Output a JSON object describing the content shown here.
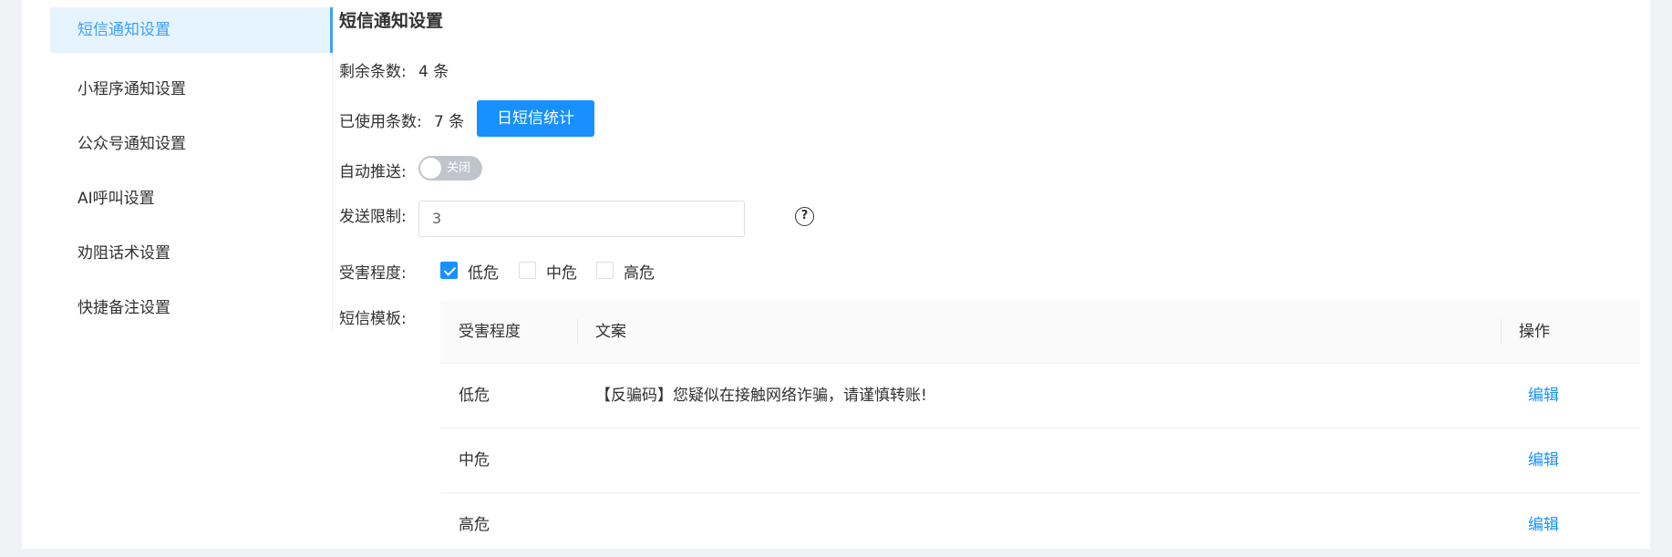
{
  "sidebar": {
    "items": [
      {
        "label": "短信通知设置",
        "active": true
      },
      {
        "label": "小程序通知设置"
      },
      {
        "label": "公众号通知设置"
      },
      {
        "label": "AI呼叫设置"
      },
      {
        "label": "劝阻话术设置"
      },
      {
        "label": "快捷备注设置"
      }
    ]
  },
  "main": {
    "title": "短信通知设置",
    "remaining_label": "剩余条数:",
    "remaining_value": "4 条",
    "used_label": "已使用条数:",
    "used_value": "7 条",
    "stats_button": "日短信统计",
    "auto_push_label": "自动推送:",
    "auto_push_state": "关闭",
    "send_limit_label": "发送限制:",
    "send_limit_value": "3",
    "help_icon": "question-circle-icon",
    "severity_label": "受害程度:",
    "severity_options": [
      {
        "label": "低危",
        "checked": true
      },
      {
        "label": "中危",
        "checked": false
      },
      {
        "label": "高危",
        "checked": false
      }
    ],
    "template_label": "短信模板:",
    "table": {
      "headers": [
        "受害程度",
        "文案",
        "操作"
      ],
      "rows": [
        {
          "severity": "低危",
          "text": "【反骗码】您疑似在接触网络诈骗，请谨慎转账!",
          "action": "编辑"
        },
        {
          "severity": "中危",
          "text": "",
          "action": "编辑"
        },
        {
          "severity": "高危",
          "text": "",
          "action": "编辑"
        }
      ]
    }
  },
  "colors": {
    "accent": "#1890ff",
    "active_bg": "#e6f4ff",
    "page_bg": "#f0f2f5"
  }
}
